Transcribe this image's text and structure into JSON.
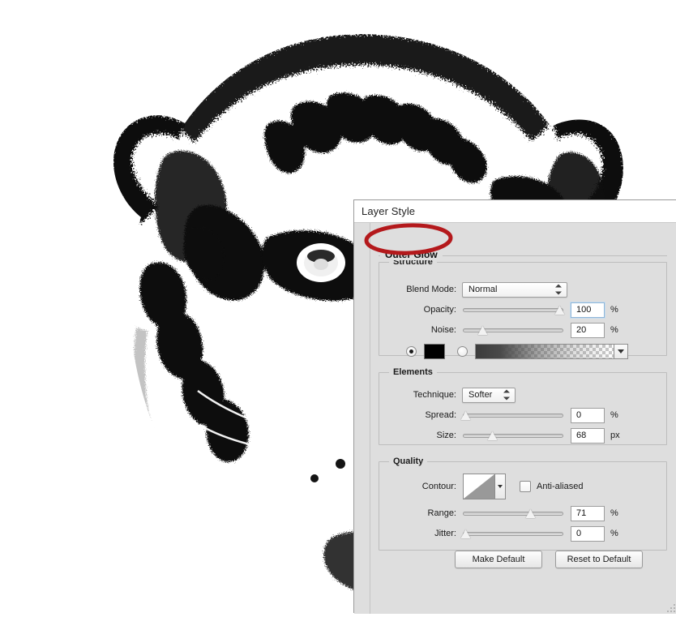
{
  "canvas": {
    "background_color": "#ffffff",
    "artwork_name": "tiger-head-black-and-white",
    "artwork_description": "High-contrast black and white threshold image of a tiger head with noisy dithered edges"
  },
  "dialog": {
    "title": "Layer Style",
    "panel_header": "Outer Glow",
    "background_color": "#dedede",
    "sections": {
      "structure": {
        "title": "Structure",
        "blend_mode": {
          "label": "Blend Mode:",
          "label_mnemonic": "B",
          "value": "Normal"
        },
        "opacity": {
          "label": "Opacity:",
          "label_mnemonic": "O",
          "value": "100",
          "unit": "%",
          "slider_percent": 100,
          "focused": true
        },
        "noise": {
          "label": "Noise:",
          "label_mnemonic": "N",
          "value": "20",
          "unit": "%",
          "slider_percent": 20,
          "focused": false
        },
        "fill_type": {
          "color_selected": true,
          "gradient_selected": false,
          "color_value": "#000000",
          "gradient_description": "dark gray to transparent"
        }
      },
      "elements": {
        "title": "Elements",
        "technique": {
          "label": "Technique:",
          "label_mnemonic": "T",
          "value": "Softer"
        },
        "spread": {
          "label": "Spread:",
          "label_mnemonic": "S",
          "value": "0",
          "unit": "%",
          "slider_percent": 0
        },
        "size": {
          "label": "Size:",
          "label_mnemonic": "S",
          "value": "68",
          "unit": "px",
          "slider_percent": 30
        }
      },
      "quality": {
        "title": "Quality",
        "contour": {
          "label": "Contour:",
          "shape": "linear-ramp"
        },
        "anti_aliased": {
          "label": "Anti-aliased",
          "label_mnemonic": "l",
          "checked": false
        },
        "range": {
          "label": "Range:",
          "label_mnemonic": "R",
          "value": "71",
          "unit": "%",
          "slider_percent": 68
        },
        "jitter": {
          "label": "Jitter:",
          "label_mnemonic": "J",
          "value": "0",
          "unit": "%",
          "slider_percent": 0
        }
      }
    },
    "buttons": {
      "make_default": "Make Default",
      "reset_to_default": "Reset to Default"
    }
  },
  "annotation": {
    "shape": "ellipse",
    "color": "#b4191c",
    "target": "Outer Glow"
  }
}
